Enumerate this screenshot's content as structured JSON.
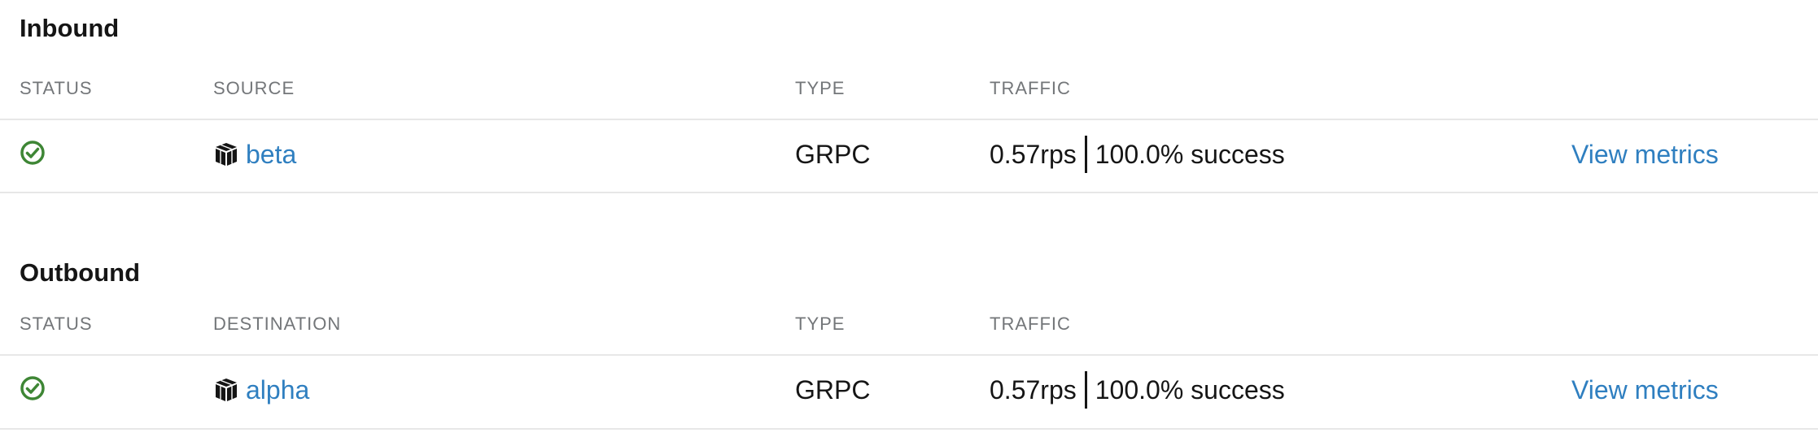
{
  "inbound": {
    "title": "Inbound",
    "headers": {
      "status": "STATUS",
      "resource": "SOURCE",
      "type": "TYPE",
      "traffic": "TRAFFIC"
    },
    "rows": [
      {
        "status_icon": "check-circle-icon",
        "resource_icon": "cube-icon",
        "name": "beta",
        "type": "GRPC",
        "rps": "0.57rps",
        "success": "100.0% success",
        "action": "View metrics"
      }
    ]
  },
  "outbound": {
    "title": "Outbound",
    "headers": {
      "status": "STATUS",
      "resource": "DESTINATION",
      "type": "TYPE",
      "traffic": "TRAFFIC"
    },
    "rows": [
      {
        "status_icon": "check-circle-icon",
        "resource_icon": "cube-icon",
        "name": "alpha",
        "type": "GRPC",
        "rps": "0.57rps",
        "success": "100.0% success",
        "action": "View metrics"
      }
    ]
  },
  "colors": {
    "link": "#2f7fc0",
    "success": "#3e8635",
    "header": "#737679",
    "divider": "#e7e7e7"
  }
}
